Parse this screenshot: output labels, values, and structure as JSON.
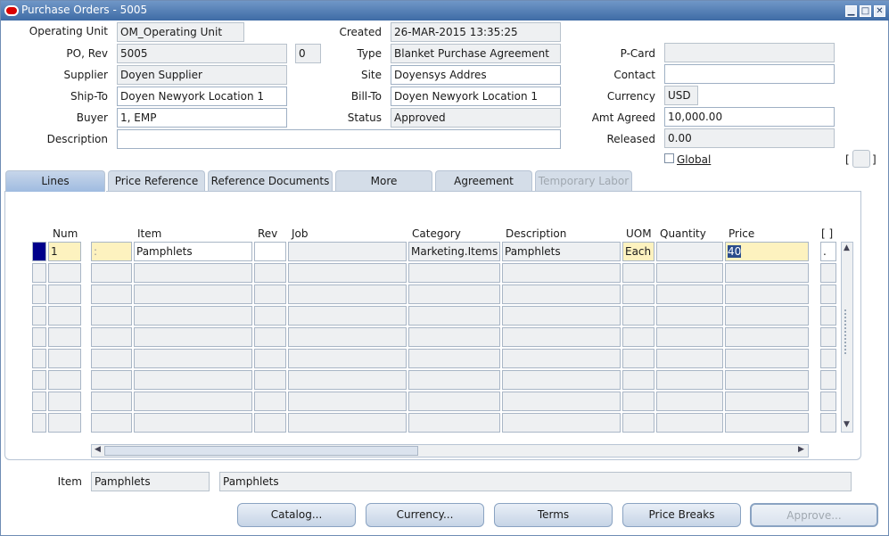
{
  "window": {
    "title": "Purchase Orders - 5005"
  },
  "header": {
    "operating_unit_label": "Operating Unit",
    "operating_unit": "OM_Operating Unit",
    "created_label": "Created",
    "created": "26-MAR-2015 13:35:25",
    "po_rev_label": "PO, Rev",
    "po": "5005",
    "rev": "0",
    "type_label": "Type",
    "type": "Blanket Purchase Agreement",
    "pcard_label": "P-Card",
    "pcard": "",
    "supplier_label": "Supplier",
    "supplier": "Doyen Supplier",
    "site_label": "Site",
    "site": "Doyensys Addres",
    "contact_label": "Contact",
    "contact": "",
    "shipto_label": "Ship-To",
    "shipto": "Doyen Newyork Location 1",
    "billto_label": "Bill-To",
    "billto": "Doyen Newyork Location 1",
    "currency_label": "Currency",
    "currency": "USD",
    "buyer_label": "Buyer",
    "buyer": "1, EMP",
    "status_label": "Status",
    "status": "Approved",
    "amt_agreed_label": "Amt Agreed",
    "amt_agreed": "10,000.00",
    "description_label": "Description",
    "description": "",
    "released_label": "Released",
    "released": "0.00",
    "global_label": "Global",
    "global_checked": false,
    "bracket_left": "[",
    "bracket_right": "]"
  },
  "tabs": [
    {
      "label": "Lines",
      "active": true
    },
    {
      "label": "Price Reference"
    },
    {
      "label": "Reference Documents"
    },
    {
      "label": "More"
    },
    {
      "label": "Agreement"
    },
    {
      "label": "Temporary Labor",
      "disabled": true
    }
  ],
  "lines": {
    "columns": {
      "num": "Num",
      "item": "Item",
      "rev": "Rev",
      "job": "Job",
      "category": "Category",
      "description": "Description",
      "uom": "UOM",
      "quantity": "Quantity",
      "price": "Price",
      "extra": "[ ]"
    },
    "row1": {
      "num": "1",
      "type": ":",
      "item": "Pamphlets",
      "rev": "",
      "job": "",
      "category": "Marketing.Items",
      "description": "Pamphlets",
      "uom": "Each",
      "quantity": "",
      "price": "40",
      "extra": "."
    }
  },
  "footer": {
    "item_label": "Item",
    "item": "Pamphlets",
    "item_desc": "Pamphlets"
  },
  "buttons": {
    "catalog": "Catalog...",
    "currency": "Currency...",
    "terms": "Terms",
    "price_breaks": "Price Breaks",
    "approve": "Approve..."
  }
}
